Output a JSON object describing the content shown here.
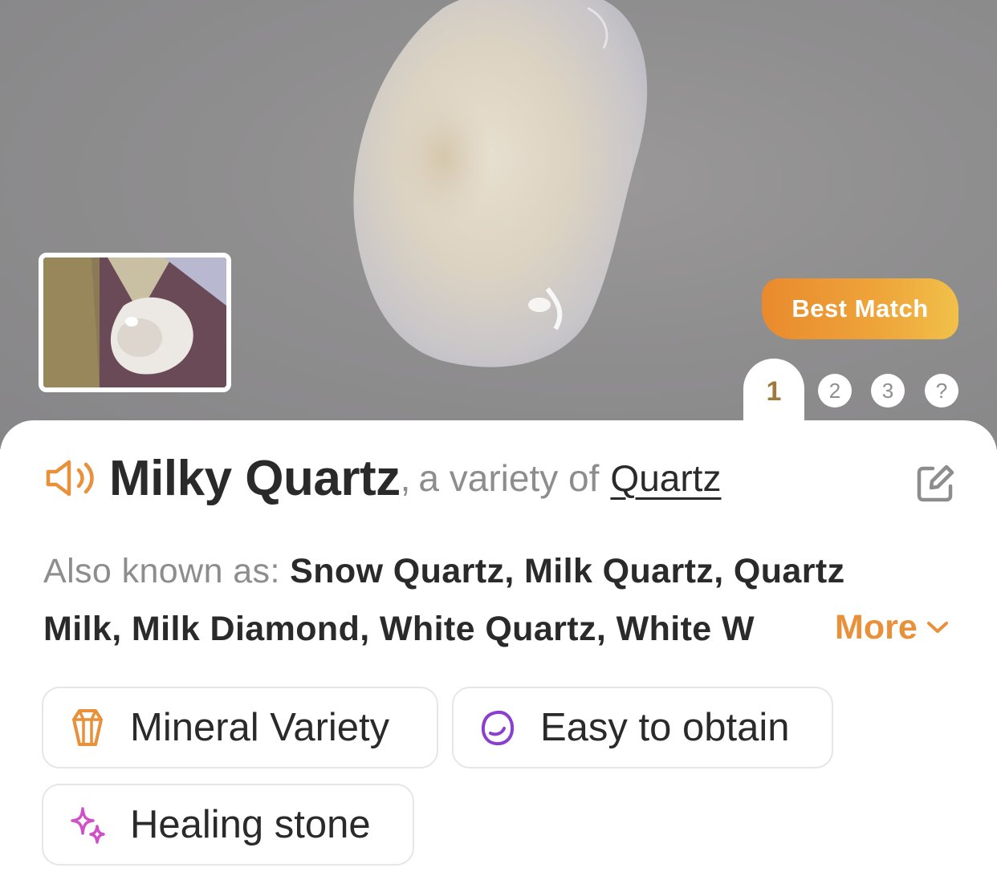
{
  "hero": {
    "badge": "Best Match",
    "tabs": [
      {
        "label": "1",
        "active": true
      },
      {
        "label": "2",
        "active": false
      },
      {
        "label": "3",
        "active": false
      },
      {
        "label": "?",
        "active": false
      }
    ]
  },
  "identification": {
    "name": "Milky Quartz",
    "separator": ",",
    "variety_text": "a variety of",
    "parent_link": "Quartz",
    "speaker_icon": "speaker-icon",
    "edit_icon": "edit-icon"
  },
  "aliases": {
    "label": "Also known as:",
    "line1": "Snow Quartz, Milk Quartz, Quartz",
    "line2": "Milk, Milk Diamond, White Quartz, White W",
    "more_label": "More"
  },
  "tags": [
    {
      "label": "Mineral Variety",
      "icon": "crystal-icon",
      "color": "#e8903a"
    },
    {
      "label": "Easy to obtain",
      "icon": "stone-icon",
      "color": "#8a3fd1"
    },
    {
      "label": "Healing stone",
      "icon": "sparkle-icon",
      "color": "#d14fc8"
    }
  ],
  "colors": {
    "accent": "#e8903a",
    "text": "#2a2a2a",
    "muted": "#8d8d8d"
  }
}
